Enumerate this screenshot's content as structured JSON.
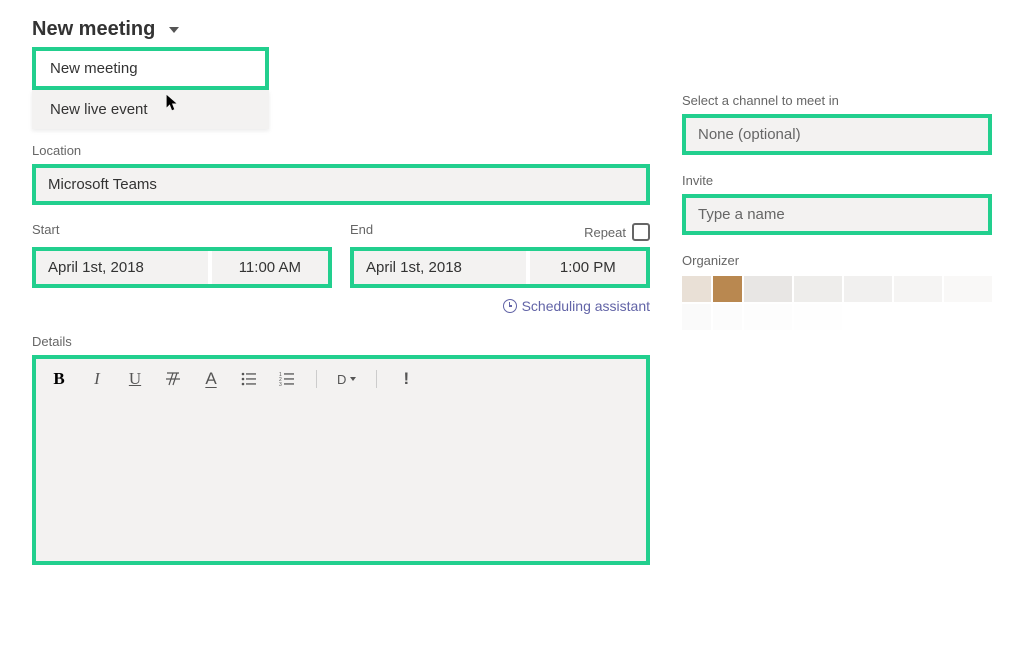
{
  "header": {
    "title": "New meeting"
  },
  "dropdown": {
    "item1": "New meeting",
    "item2": "New live event"
  },
  "location": {
    "label": "Location",
    "value": "Microsoft Teams"
  },
  "start": {
    "label": "Start",
    "date": "April 1st, 2018",
    "time": "11:00 AM"
  },
  "end": {
    "label": "End",
    "date": "April 1st, 2018",
    "time": "1:00 PM"
  },
  "repeat": {
    "label": "Repeat"
  },
  "scheduling": {
    "label": "Scheduling assistant"
  },
  "details": {
    "label": "Details",
    "toolbar": {
      "bold": "B",
      "italic": "I",
      "underline": "U",
      "font": "A",
      "para": "D",
      "important": "!"
    }
  },
  "channel": {
    "label": "Select a channel to meet in",
    "placeholder": "None (optional)"
  },
  "invite": {
    "label": "Invite",
    "placeholder": "Type a name"
  },
  "organizer": {
    "label": "Organizer"
  }
}
